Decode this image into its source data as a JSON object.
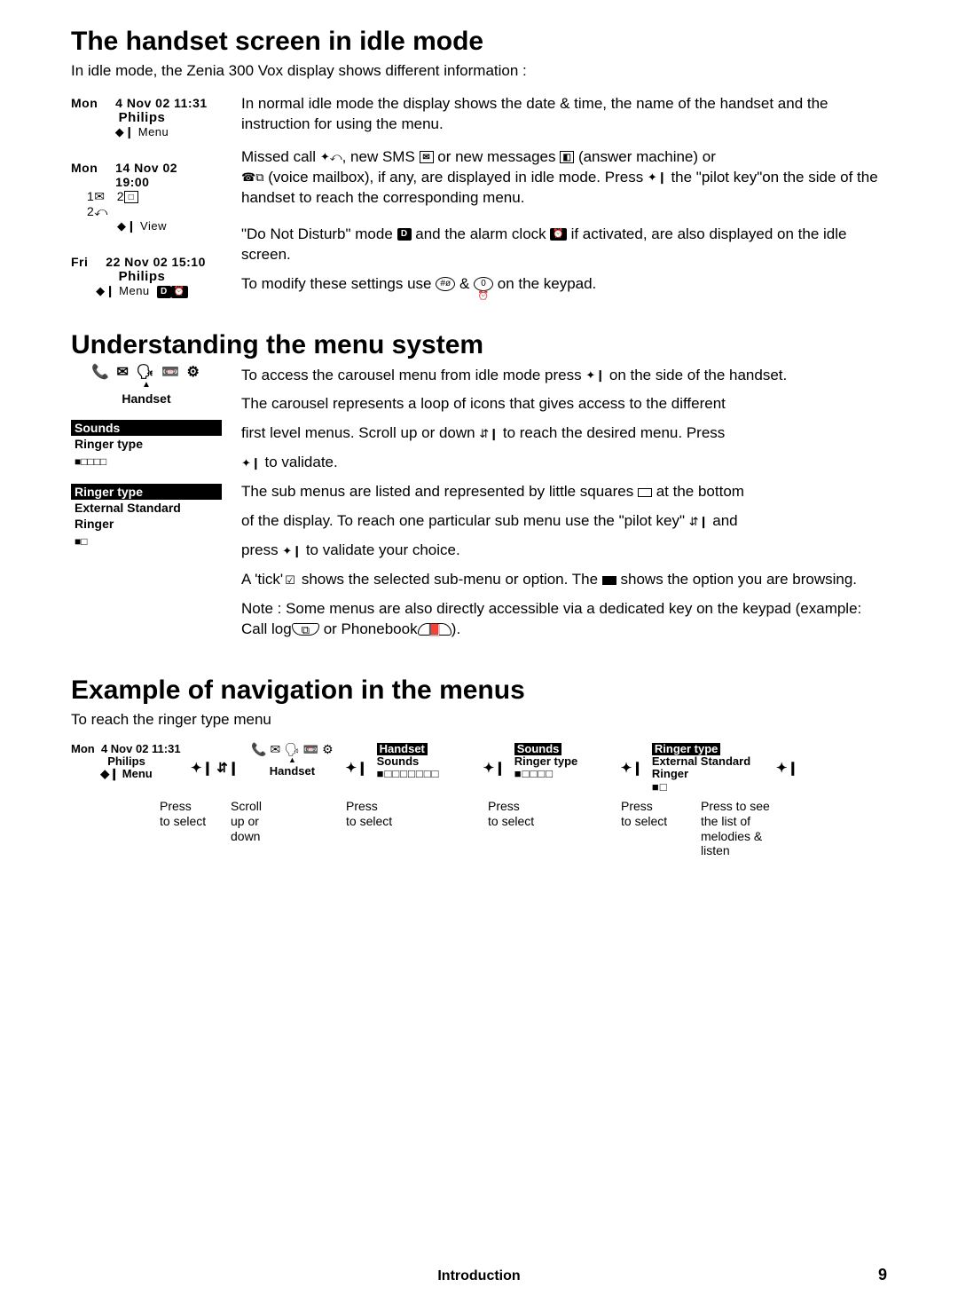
{
  "section1": {
    "heading": "The handset screen in idle mode",
    "intro": "In idle mode, the Zenia 300 Vox display shows different information :",
    "lcd1": {
      "day": "Mon",
      "date": "4 Nov 02 11:31",
      "name": "Philips",
      "hint": "◆❙ Menu"
    },
    "para1": "In normal idle mode the display shows the date & time, the name of the handset and the instruction for using the menu.",
    "lcd2": {
      "day": "Mon",
      "date": "14 Nov 02 19:00",
      "row2a": "1",
      "row2b": "2",
      "row3": "2",
      "hint": "◆❙ View"
    },
    "para2_a": "Missed call ",
    "para2_b": ", new SMS ",
    "para2_c": " or new messages ",
    "para2_d": " (answer machine) or",
    "para2_e": " (voice mailbox), if any, are displayed in idle mode. Press ",
    "para2_f": " the \"pilot key\"on the side of the handset to reach the corresponding menu.",
    "lcd3": {
      "day": "Fri",
      "date": "22 Nov 02 15:10",
      "name": "Philips",
      "hint": "◆❙ Menu"
    },
    "para3_a": "\"Do Not Disturb\" mode ",
    "para3_b": " and the alarm clock ",
    "para3_c": " if activated, are also displayed on the idle screen.",
    "para3_d": "To modify these settings use ",
    "para3_e": " & ",
    "para3_f": " on the keypad."
  },
  "section2": {
    "heading": "Understanding the menu system",
    "carousel_label": "Handset",
    "menu1": {
      "bar": "Sounds",
      "item": "Ringer type",
      "dots": "■□□□□"
    },
    "menu2": {
      "bar": "Ringer type",
      "item1": "External Standard",
      "item2": "Ringer",
      "dots": "■□"
    },
    "p1": "To access the carousel menu from idle mode press ",
    "p1b": " on the side of the handset.",
    "p2": "The carousel represents a loop of icons that gives access to the different",
    "p3a": "first level menus. Scroll up or down ",
    "p3b": " to reach the desired menu. Press",
    "p4": " to validate.",
    "p5a": "The sub menus are listed and represented by little squares ",
    "p5b": " at the bottom",
    "p6a": "of the display. To reach one particular sub menu use the \"pilot key\" ",
    "p6b": " and",
    "p7a": "press ",
    "p7b": " to validate your choice.",
    "p8a": "A 'tick'",
    "p8b": " shows the selected sub-menu or option. The ",
    "p8c": " shows the option you are browsing.",
    "p9a": "Note : Some menus are also directly accessible via a dedicated key on the keypad (example: Call log",
    "p9b": " or Phonebook",
    "p9c": ")."
  },
  "section3": {
    "heading": "Example of navigation in the menus",
    "intro": "To reach the ringer type menu",
    "step1": {
      "day": "Mon",
      "date": "4 Nov 02 11:31",
      "name": "Philips",
      "hint": "◆❙ Menu"
    },
    "step2_label": "Handset",
    "step3": {
      "bar": "Handset",
      "item": "Sounds",
      "dots": "■□□□□□□□"
    },
    "step4": {
      "bar": "Sounds",
      "item": "Ringer type",
      "dots": "■□□□□"
    },
    "step5": {
      "bar": "Ringer type",
      "item1": "External Standard",
      "item2": "Ringer",
      "dots": "■□"
    },
    "cap1": "Press\nto select",
    "cap2": "Scroll\nup or\ndown",
    "cap3": "Press\nto select",
    "cap4": "Press\nto select",
    "cap5": "Press\nto select",
    "cap6": "Press to see\nthe list of\nmelodies &\nlisten"
  },
  "footer": "Introduction",
  "page": "9"
}
